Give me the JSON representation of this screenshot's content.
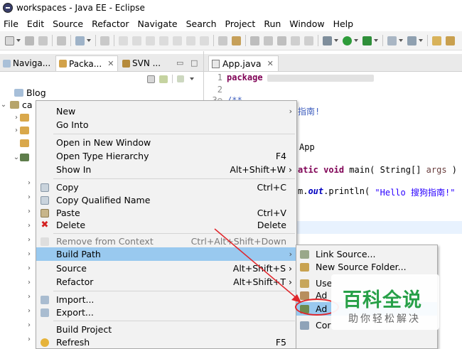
{
  "window": {
    "title": "workspaces - Java EE - Eclipse"
  },
  "menubar": [
    "File",
    "Edit",
    "Source",
    "Refactor",
    "Navigate",
    "Search",
    "Project",
    "Run",
    "Window",
    "Help"
  ],
  "left_tabs": [
    {
      "label": "Naviga..."
    },
    {
      "label": "Packa...",
      "close": "✕"
    },
    {
      "label": "SVN ..."
    }
  ],
  "tree": {
    "blog": "Blog",
    "project": "ca"
  },
  "editor": {
    "tab": "App.java",
    "tab_close": "✕",
    "lines": [
      {
        "n": "1",
        "kw": "package"
      },
      {
        "n": "2"
      },
      {
        "n": "3⊖",
        "cm": "/**"
      }
    ],
    "fragments": {
      "comment_cn": "指南!",
      "class_name": "App",
      "main_kw1": "atic",
      "main_kw2": "void",
      "main_sig": " main( String[] ",
      "main_args": "args",
      "main_end": " )",
      "print_pre": "m.",
      "print_out": "out",
      "print_call": ".println( ",
      "print_str": "\"Hello 搜狗指南!\""
    }
  },
  "context_menu": {
    "items": [
      {
        "label": "New",
        "submenu": "›"
      },
      {
        "label": "Go Into"
      },
      {
        "label": "Open in New Window"
      },
      {
        "label": "Open Type Hierarchy",
        "shortcut": "F4"
      },
      {
        "label": "Show In",
        "shortcut": "Alt+Shift+W ›"
      },
      {
        "label": "Copy",
        "shortcut": "Ctrl+C"
      },
      {
        "label": "Copy Qualified Name"
      },
      {
        "label": "Paste",
        "shortcut": "Ctrl+V"
      },
      {
        "label": "Delete",
        "shortcut": "Delete"
      },
      {
        "label": "Remove from Context",
        "shortcut": "Ctrl+Alt+Shift+Down",
        "disabled": true
      },
      {
        "label": "Build Path",
        "submenu": "›",
        "selected": true
      },
      {
        "label": "Source",
        "shortcut": "Alt+Shift+S ›"
      },
      {
        "label": "Refactor",
        "shortcut": "Alt+Shift+T ›"
      },
      {
        "label": "Import..."
      },
      {
        "label": "Export..."
      },
      {
        "label": "Build Project"
      },
      {
        "label": "Refresh",
        "shortcut": "F5"
      }
    ]
  },
  "submenu": {
    "items": [
      {
        "label": "Link Source..."
      },
      {
        "label": "New Source Folder..."
      },
      {
        "label": "Use"
      },
      {
        "label": "Ad"
      },
      {
        "label": "Ad",
        "selected": true
      },
      {
        "label": "Cor"
      }
    ]
  },
  "watermark": {
    "title": "百科全说",
    "subtitle": "助你轻松解决"
  },
  "colors": {
    "selection": "#99c9ef",
    "highlight_ring": "#e0252b",
    "watermark_green": "#27a048"
  }
}
